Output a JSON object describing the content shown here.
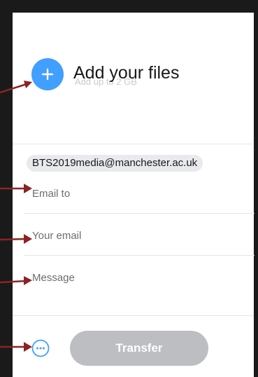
{
  "upload": {
    "title": "Add your files",
    "subtitle": "Add up to 2 GB",
    "add_icon": "plus-icon"
  },
  "form": {
    "recipient_chip": "BTS2019media@manchester.ac.uk",
    "email_to_placeholder": "Email to",
    "your_email_placeholder": "Your email",
    "message_placeholder": "Message"
  },
  "footer": {
    "more_icon": "more-options-icon",
    "transfer_label": "Transfer"
  },
  "colors": {
    "accent": "#409fff",
    "transfer_disabled": "#bcbec1",
    "annotation_arrow": "#8b2323"
  }
}
